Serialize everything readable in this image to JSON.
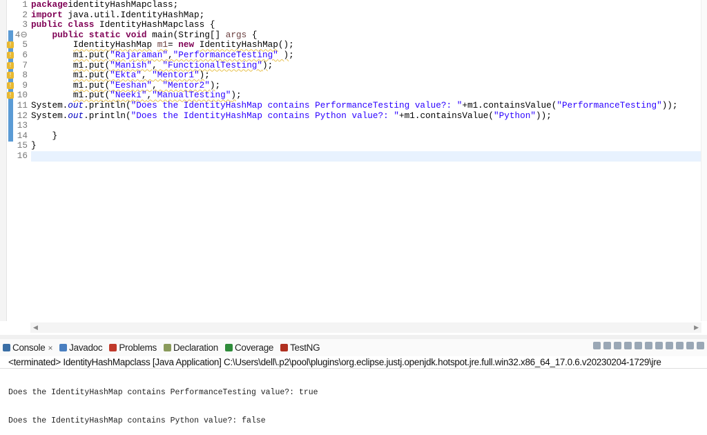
{
  "editor": {
    "lines": [
      [
        [
          "kw",
          "package"
        ],
        [
          "",
          "identityHashMapclass;"
        ]
      ],
      [
        [
          "kw",
          "import"
        ],
        [
          "",
          " java.util.IdentityHashMap;"
        ]
      ],
      [
        [
          "kw",
          "public"
        ],
        [
          "",
          " "
        ],
        [
          "kw",
          "class"
        ],
        [
          "",
          " IdentityHashMapclass {"
        ]
      ],
      [
        [
          "",
          "    "
        ],
        [
          "kw",
          "public"
        ],
        [
          "",
          " "
        ],
        [
          "kw",
          "static"
        ],
        [
          "",
          " "
        ],
        [
          "kw",
          "void"
        ],
        [
          "",
          " main(String[] "
        ],
        [
          "var",
          "args"
        ],
        [
          "",
          " {"
        ]
      ],
      [
        [
          "",
          "        "
        ],
        [
          "warn",
          "IdentityHashMap"
        ],
        [
          "",
          " "
        ],
        [
          "var warn",
          "m1"
        ],
        [
          "",
          "= "
        ],
        [
          "kw",
          "new"
        ],
        [
          "",
          " "
        ],
        [
          "warn",
          "IdentityHashMap"
        ],
        [
          "",
          "();"
        ]
      ],
      [
        [
          "",
          "        "
        ],
        [
          "warn",
          "m1.put("
        ],
        [
          "str warn",
          "\"Rajaraman\""
        ],
        [
          "warn",
          ","
        ],
        [
          "str warn",
          "\"PerformanceTesting\""
        ],
        [
          "warn",
          " )"
        ],
        [
          "",
          ";"
        ]
      ],
      [
        [
          "",
          "        "
        ],
        [
          "warn",
          "m1.put("
        ],
        [
          "str warn",
          "\"Manish\""
        ],
        [
          "warn",
          ", "
        ],
        [
          "str warn",
          "\"FunctionalTesting\""
        ],
        [
          "warn",
          ")"
        ],
        [
          "",
          ";"
        ]
      ],
      [
        [
          "",
          "        "
        ],
        [
          "warn",
          "m1.put("
        ],
        [
          "str warn",
          "\"Ekta\""
        ],
        [
          "warn",
          ", "
        ],
        [
          "str warn",
          "\"Mentor1\""
        ],
        [
          "warn",
          ")"
        ],
        [
          "",
          ";"
        ]
      ],
      [
        [
          "",
          "        "
        ],
        [
          "warn",
          "m1.put("
        ],
        [
          "str warn",
          "\"Eeshan\""
        ],
        [
          "warn",
          ", "
        ],
        [
          "str warn",
          "\"Mentor2\""
        ],
        [
          "warn",
          ")"
        ],
        [
          "",
          ";"
        ]
      ],
      [
        [
          "",
          "        "
        ],
        [
          "warn",
          "m1.put("
        ],
        [
          "str warn",
          "\"Neeki\""
        ],
        [
          "warn",
          ","
        ],
        [
          "str warn",
          "\"ManualTesting\""
        ],
        [
          "warn",
          ")"
        ],
        [
          "",
          ";"
        ]
      ],
      [
        [
          "",
          "System."
        ],
        [
          "fld",
          "out"
        ],
        [
          "",
          ".println("
        ],
        [
          "str",
          "\"Does the IdentityHashMap contains PerformanceTesting value?: \""
        ],
        [
          "",
          "+m1.containsValue("
        ],
        [
          "str",
          "\"PerformanceTesting\""
        ],
        [
          "",
          "));"
        ]
      ],
      [
        [
          "",
          "System."
        ],
        [
          "fld",
          "out"
        ],
        [
          "",
          ".println("
        ],
        [
          "str",
          "\"Does the IdentityHashMap contains Python value?: \""
        ],
        [
          "",
          "+m1.containsValue("
        ],
        [
          "str",
          "\"Python\""
        ],
        [
          "",
          "));"
        ]
      ],
      [
        [
          "",
          ""
        ]
      ],
      [
        [
          "",
          "    }"
        ]
      ],
      [
        [
          "",
          "}"
        ]
      ],
      [
        [
          "",
          ""
        ]
      ]
    ],
    "line_numbers": [
      "1",
      "2",
      "3",
      "4⊖",
      "5",
      "6",
      "7",
      "8",
      "9",
      "10",
      "11",
      "12",
      "13",
      "14",
      "15",
      "16"
    ],
    "warning_lines": [
      5,
      6,
      7,
      8,
      9,
      10
    ]
  },
  "panel": {
    "tabs": [
      {
        "label": "Console",
        "icon": "console-icon",
        "color": "#3a6ea5",
        "close": "×"
      },
      {
        "label": "Javadoc",
        "icon": "javadoc-icon",
        "color": "#4a7fc0"
      },
      {
        "label": "Problems",
        "icon": "problems-icon",
        "color": "#c0392b"
      },
      {
        "label": "Declaration",
        "icon": "declaration-icon",
        "color": "#8a9a5b"
      },
      {
        "label": "Coverage",
        "icon": "coverage-icon",
        "color": "#2e8b3a"
      },
      {
        "label": "TestNG",
        "icon": "testng-icon",
        "color": "#b03020"
      }
    ],
    "status": "<terminated> IdentityHashMapclass [Java Application] C:\\Users\\dell\\.p2\\pool\\plugins\\org.eclipse.justj.openjdk.hotspot.jre.full.win32.x86_64_17.0.6.v20230204-1729\\jre",
    "output": [
      "Does the IdentityHashMap contains PerformanceTesting value?: true",
      "Does the IdentityHashMap contains Python value?: false"
    ]
  }
}
